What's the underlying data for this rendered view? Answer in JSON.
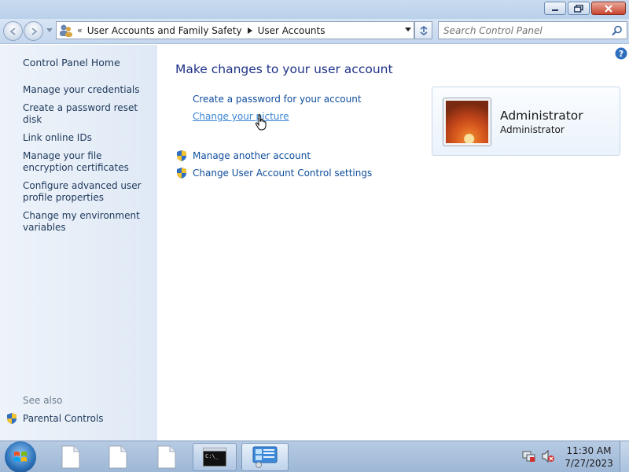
{
  "window": {
    "icons": {
      "minimize": "minimize-icon",
      "maximize": "maximize-icon",
      "close": "close-icon"
    }
  },
  "navigation": {
    "breadcrumbs": [
      "User Accounts and Family Safety",
      "User Accounts"
    ],
    "search_placeholder": "Search Control Panel"
  },
  "sidebar": {
    "home": "Control Panel Home",
    "tasks": [
      "Manage your credentials",
      "Create a password reset disk",
      "Link online IDs",
      "Manage your file encryption certificates",
      "Configure advanced user profile properties",
      "Change my environment variables"
    ],
    "see_also_label": "See also",
    "see_also_items": [
      "Parental Controls"
    ]
  },
  "main": {
    "title": "Make changes to your user account",
    "links": [
      "Create a password for your account",
      "Change your picture"
    ],
    "shield_links": [
      "Manage another account",
      "Change User Account Control settings"
    ]
  },
  "account": {
    "name": "Administrator",
    "role": "Administrator"
  },
  "taskbar": {
    "time": "11:30 AM",
    "date": "7/27/2023",
    "items": [
      "file-icon",
      "file-icon",
      "file-icon",
      "command-prompt-icon",
      "control-panel-icon"
    ]
  },
  "colors": {
    "link": "#0e4d9b",
    "title": "#1e3287",
    "hover_link": "#3a86d6",
    "sidebar_bg": "#e4edf7"
  }
}
